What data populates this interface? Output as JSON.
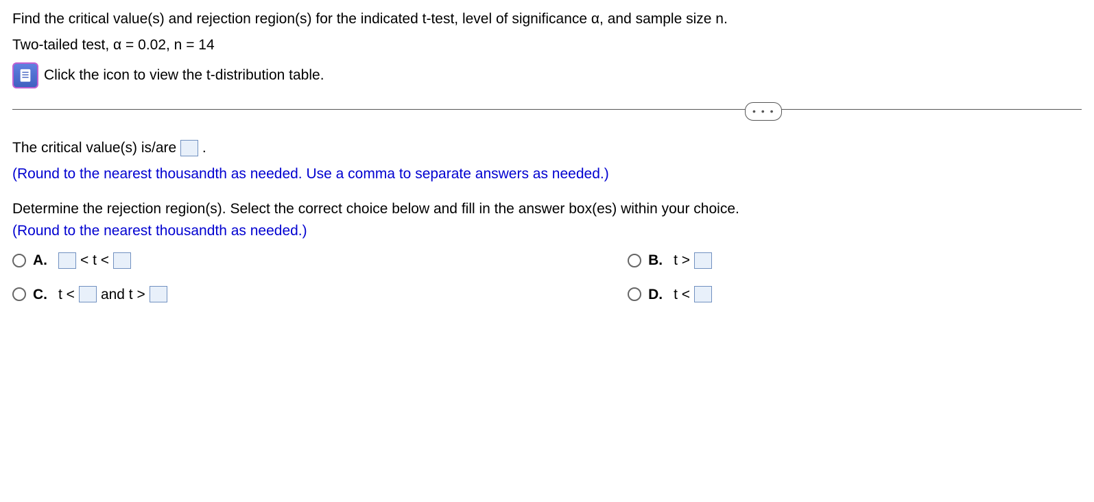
{
  "problem": {
    "line1": "Find the critical value(s) and rejection region(s) for the indicated t-test, level of significance α, and sample size n.",
    "line2": "Two-tailed test, α = 0.02, n = 14",
    "icon_text": "Click the icon to view the t-distribution table."
  },
  "divider_dots": "• • •",
  "critical_value": {
    "prefix": "The critical value(s) is/are ",
    "suffix": ".",
    "hint": "(Round to the nearest thousandth as needed. Use a comma to separate answers as needed.)"
  },
  "rejection": {
    "prompt": "Determine the rejection region(s). Select the correct choice below and fill in the answer box(es) within your choice.",
    "hint": "(Round to the nearest thousandth as needed.)"
  },
  "choices": {
    "a": {
      "label": "A.",
      "mid": "< t <"
    },
    "b": {
      "label": "B.",
      "prefix": "t >"
    },
    "c": {
      "label": "C.",
      "prefix": "t <",
      "mid": "and t >"
    },
    "d": {
      "label": "D.",
      "prefix": "t <"
    }
  }
}
